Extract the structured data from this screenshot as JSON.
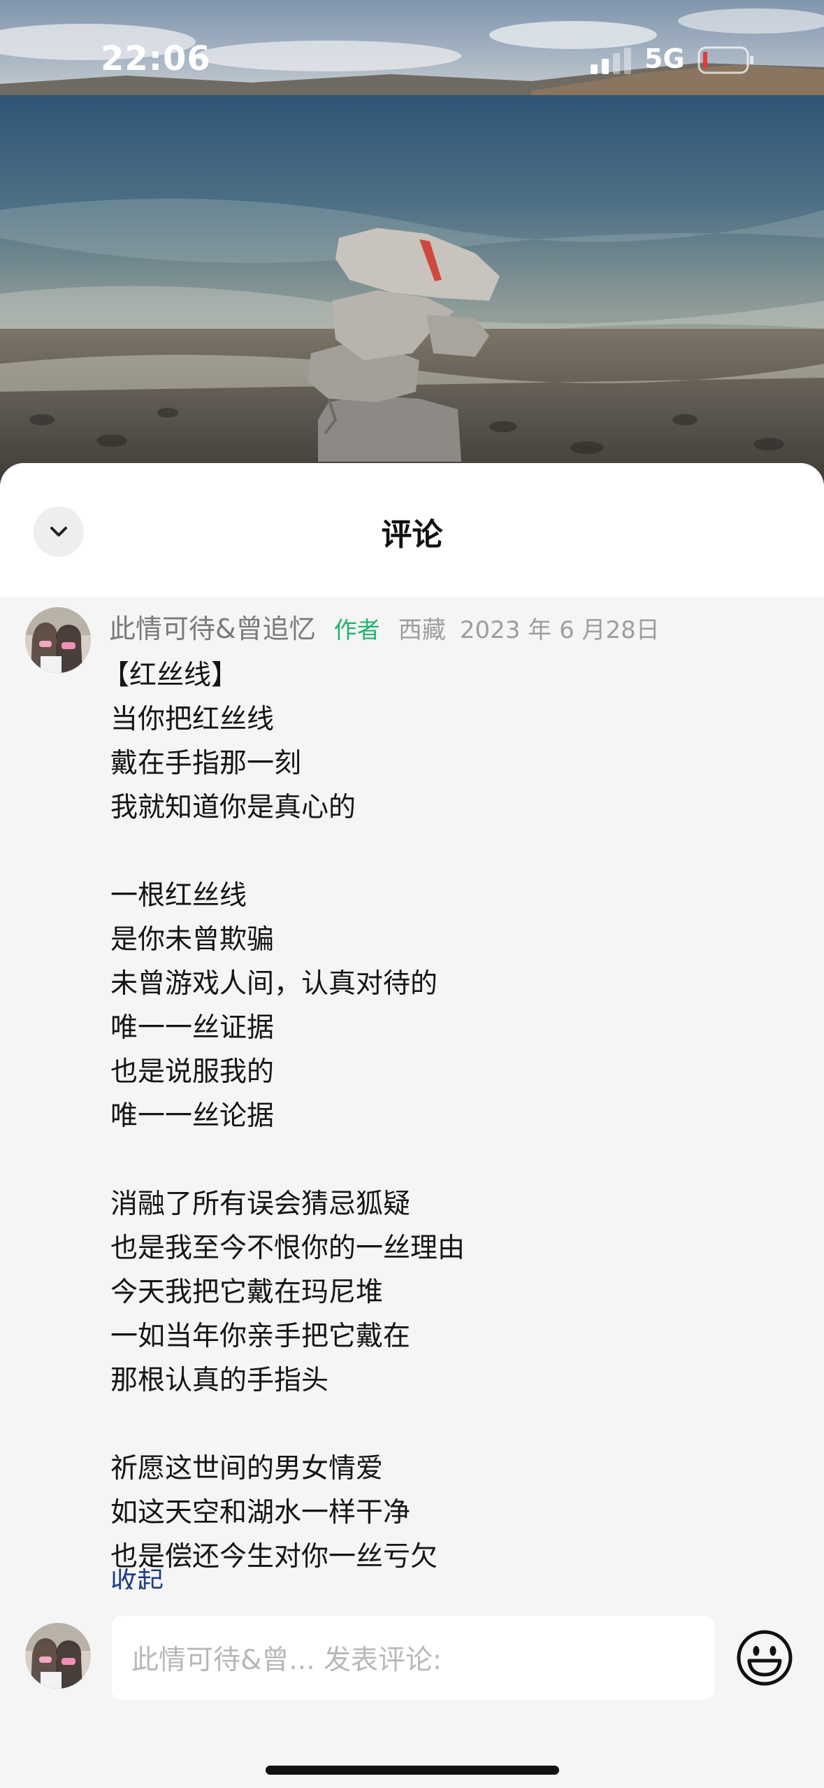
{
  "status_bar": {
    "time": "22:06",
    "network": "5G",
    "signal_icon": "signal-bars-icon",
    "battery_icon": "battery-low-icon"
  },
  "sheet": {
    "title": "评论",
    "collapse_icon": "chevron-down-icon"
  },
  "comment": {
    "author": "此情可待&曾追忆",
    "badge": "作者",
    "location": "西藏",
    "date": "2023 年 6 月28日",
    "poem_title": "【红丝线】",
    "stanzas": [
      [
        "当你把红丝线",
        "戴在手指那一刻",
        "我就知道你是真心的"
      ],
      [
        "一根红丝线",
        "是你未曾欺骗",
        "未曾游戏人间，认真对待的",
        "唯一一丝证据",
        "也是说服我的",
        "唯一一丝论据"
      ],
      [
        "消融了所有误会猜忌狐疑",
        "也是我至今不恨你的一丝理由",
        "今天我把它戴在玛尼堆",
        "一如当年你亲手把它戴在",
        "那根认真的手指头"
      ],
      [
        "祈愿这世间的男女情爱",
        "如这天空和湖水一样干净",
        "也是偿还今生对你一丝亏欠"
      ]
    ],
    "collapse_label": "收起"
  },
  "input_bar": {
    "placeholder": "此情可待&曾... 发表评论:",
    "emoji_icon": "smiley-emoji-icon"
  },
  "colors": {
    "author_badge": "#23b26d",
    "collapse_link": "#1f3f87",
    "sheet_background": "#f5f5f5"
  }
}
